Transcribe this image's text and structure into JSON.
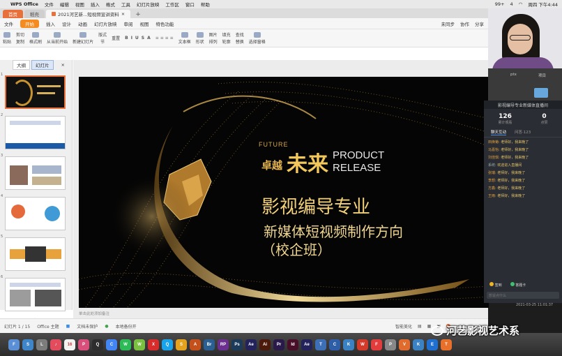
{
  "menubar": {
    "app": "WPS Office",
    "items": [
      "文件",
      "编辑",
      "视图",
      "插入",
      "格式",
      "工具",
      "幻灯片放映",
      "工作区",
      "窗口",
      "帮助"
    ],
    "status": [
      "99+",
      "4"
    ],
    "clock": "周四 下午4:44"
  },
  "tabs": [
    {
      "label": "首页"
    },
    {
      "label": "稻壳"
    },
    {
      "label": "2021河艺新...短视频宣讲资料"
    }
  ],
  "ribbon": {
    "file": "文件",
    "menus": [
      "开始",
      "插入",
      "设计",
      "动画",
      "幻灯片放映",
      "审阅",
      "视图",
      "特色功能"
    ],
    "right": [
      "未同步",
      "协作",
      "分享"
    ]
  },
  "toolbar": {
    "items": [
      "粘贴",
      "剪切",
      "复制",
      "格式刷",
      "从当前开始",
      "新建幻灯片",
      "版式",
      "重置",
      "节",
      "文本框",
      "形状",
      "排列",
      "查找",
      "替换",
      "选择窗格"
    ],
    "format_buttons": [
      "B",
      "I",
      "U",
      "S",
      "A"
    ],
    "insert": [
      "图片",
      "填充",
      "轮廓"
    ]
  },
  "panel": {
    "tabs": [
      "大纲",
      "幻灯片"
    ],
    "slide_numbers": [
      "1",
      "2",
      "3",
      "4",
      "5",
      "6"
    ]
  },
  "slide": {
    "future": "FUTURE",
    "zhuoyue": "卓越",
    "weilai": "未来",
    "product": "PRODUCT",
    "release": "RELEASE",
    "line1": "影视编导专业",
    "line2": "新媒体短视频制作方向",
    "line3": "（校企班）"
  },
  "notes": "单击此处添加备注",
  "statusbar": {
    "slide": "幻灯片 1 / 15",
    "theme": "Office 主题",
    "protect": "文档未保护",
    "backup": "本地备份开",
    "beautify": "智能美化"
  },
  "filebar": {
    "file": "ptx",
    "folder": "项目"
  },
  "live": {
    "title": "影视编导专业新媒体直播间",
    "stats": [
      {
        "value": "126",
        "label": "累计观看"
      },
      {
        "value": "0",
        "label": "点赞"
      }
    ],
    "subtabs": [
      "聊天互动",
      "问答·123"
    ],
    "messages": [
      {
        "name": "田焕菊:",
        "text": "老师好，我来晚了"
      },
      {
        "name": "马嘉怡:",
        "text": "老师好，我来晚了"
      },
      {
        "name": "刘佳琪:",
        "text": "老师好，我来晚了"
      },
      {
        "name": "系统:",
        "text": "欢迎进入直播间"
      },
      {
        "name": "张瑞:",
        "text": "老师好，我来晚了"
      },
      {
        "name": "李想:",
        "text": "老师好，我来晚了"
      },
      {
        "name": "方鑫:",
        "text": "老师好，我来晚了"
      },
      {
        "name": "王雨:",
        "text": "老师好，我来晚了"
      }
    ],
    "tools": [
      "签到",
      "答题卡"
    ],
    "input_placeholder": "想说点什么"
  },
  "timecode": "2021-03-25 11:01:37",
  "watermark": "河艺影视艺术系",
  "dock": [
    {
      "label": "F",
      "color": "#5a8fd6"
    },
    {
      "label": "S",
      "color": "#3e86c9"
    },
    {
      "label": "L",
      "color": "#7c7c7c"
    },
    {
      "label": "♪",
      "color": "#e24c5d"
    },
    {
      "label": "16",
      "color": "#f2f2f2"
    },
    {
      "label": "P",
      "color": "#d84f7b"
    },
    {
      "label": "Q",
      "color": "#2d2d2d"
    },
    {
      "label": "C",
      "color": "#4285f4"
    },
    {
      "label": "W",
      "color": "#2dbb58"
    },
    {
      "label": "W",
      "color": "#7ac142"
    },
    {
      "label": "X",
      "color": "#d62c2c"
    },
    {
      "label": "Q",
      "color": "#1aa3e8"
    },
    {
      "label": "S",
      "color": "#e5a21f"
    },
    {
      "label": "A",
      "color": "#c4501b"
    },
    {
      "label": "Br",
      "color": "#2a5f93"
    },
    {
      "label": "RP",
      "color": "#6a2f8f"
    },
    {
      "label": "Ps",
      "color": "#1c3b5a"
    },
    {
      "label": "Ae",
      "color": "#23225a"
    },
    {
      "label": "Ai",
      "color": "#4b1a0a"
    },
    {
      "label": "Pr",
      "color": "#2a1a4a"
    },
    {
      "label": "Id",
      "color": "#4a0f28"
    },
    {
      "label": "Ae",
      "color": "#23225a"
    },
    {
      "label": "T",
      "color": "#3d6fb6"
    },
    {
      "label": "C",
      "color": "#2f5ea8"
    },
    {
      "label": "K",
      "color": "#3b82c4"
    },
    {
      "label": "W",
      "color": "#d33a2a"
    },
    {
      "label": "F",
      "color": "#e23c3c"
    },
    {
      "label": "P",
      "color": "#888"
    },
    {
      "label": "V",
      "color": "#e06b2c"
    },
    {
      "label": "K",
      "color": "#3b82c4"
    },
    {
      "label": "E",
      "color": "#1f6fd0"
    },
    {
      "label": "T",
      "color": "#e8702a"
    }
  ]
}
